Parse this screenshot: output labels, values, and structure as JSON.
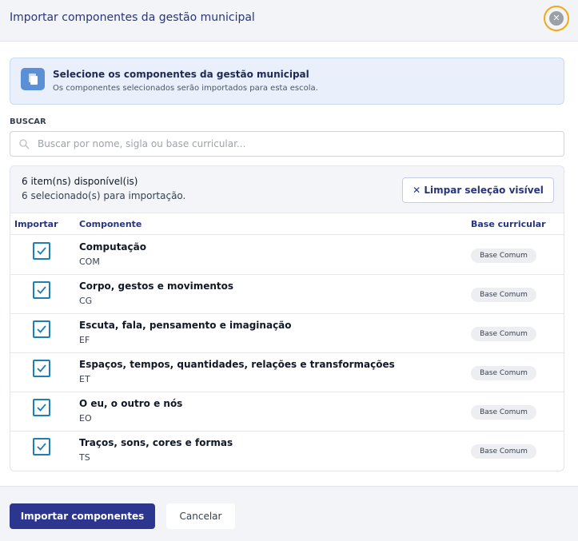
{
  "dialog": {
    "title": "Importar componentes da gestão municipal",
    "close_icon": "close-icon"
  },
  "info": {
    "icon": "copy-icon",
    "title": "Selecione os componentes da gestão municipal",
    "text": "Os componentes selecionados serão importados para esta escola."
  },
  "search": {
    "label": "BUSCAR",
    "placeholder": "Buscar por nome, sigla ou base curricular...",
    "value": "",
    "icon": "search-icon"
  },
  "summary": {
    "available": "6 item(ns) disponível(is)",
    "selected": "6 selecionado(s) para importação.",
    "clear_label": "✕ Limpar seleção visível"
  },
  "table": {
    "headers": {
      "import": "Importar",
      "component": "Componente",
      "base": "Base curricular"
    },
    "rows": [
      {
        "name": "Computação",
        "code": "COM",
        "base": "Base Comum",
        "checked": true
      },
      {
        "name": "Corpo, gestos e movimentos",
        "code": "CG",
        "base": "Base Comum",
        "checked": true
      },
      {
        "name": "Escuta, fala, pensamento e imaginação",
        "code": "EF",
        "base": "Base Comum",
        "checked": true
      },
      {
        "name": "Espaços, tempos, quantidades, relações e transformações",
        "code": "ET",
        "base": "Base Comum",
        "checked": true
      },
      {
        "name": "O eu, o outro e nós",
        "code": "EO",
        "base": "Base Comum",
        "checked": true
      },
      {
        "name": "Traços, sons, cores e formas",
        "code": "TS",
        "base": "Base Comum",
        "checked": true
      }
    ]
  },
  "footer": {
    "import_label": "Importar componentes",
    "cancel_label": "Cancelar"
  },
  "colors": {
    "primary": "#2c368f",
    "accent_focus": "#f2a818",
    "checkbox": "#1e7fb8"
  }
}
